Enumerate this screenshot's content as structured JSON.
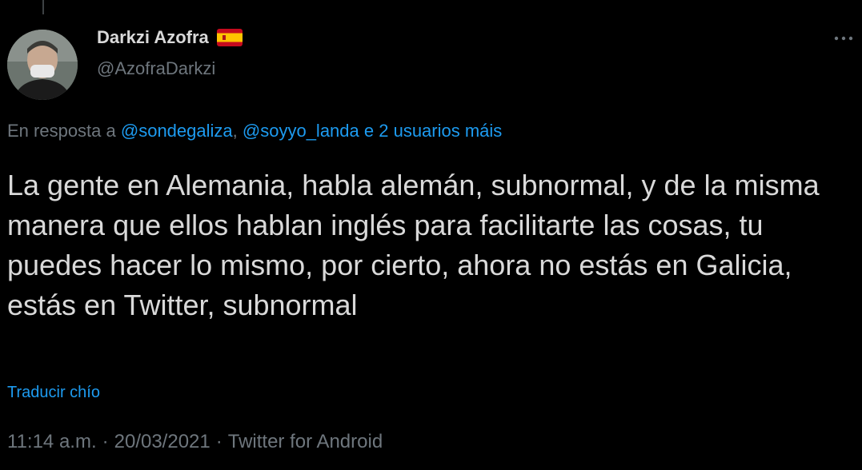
{
  "author": {
    "display_name": "Darkzi Azofra",
    "handle": "@AzofraDarkzi",
    "flag_icon": "spain-flag-icon",
    "avatar_icon": "profile-photo-avatar"
  },
  "more_icon": "more-dots-icon",
  "reply": {
    "prefix": "En resposta a",
    "mention1": "@sondegaliza",
    "comma": ",",
    "mention2": "@soyyo_landa",
    "others": "e 2 usuarios máis"
  },
  "tweet": {
    "text": "La gente en Alemania, habla alemán, subnormal, y de la misma manera que ellos hablan inglés para facilitarte las cosas, tu puedes hacer lo mismo, por cierto, ahora no estás en Galicia, estás en Twitter, subnormal"
  },
  "translate_label": "Traducir chío",
  "meta": {
    "time": "11:14 a.m.",
    "separator": "·",
    "date": "20/03/2021",
    "source": "Twitter for Android"
  },
  "colors": {
    "background": "#000000",
    "text": "#d9d9d9",
    "secondary": "#6e767d",
    "accent": "#1d9bf0"
  }
}
